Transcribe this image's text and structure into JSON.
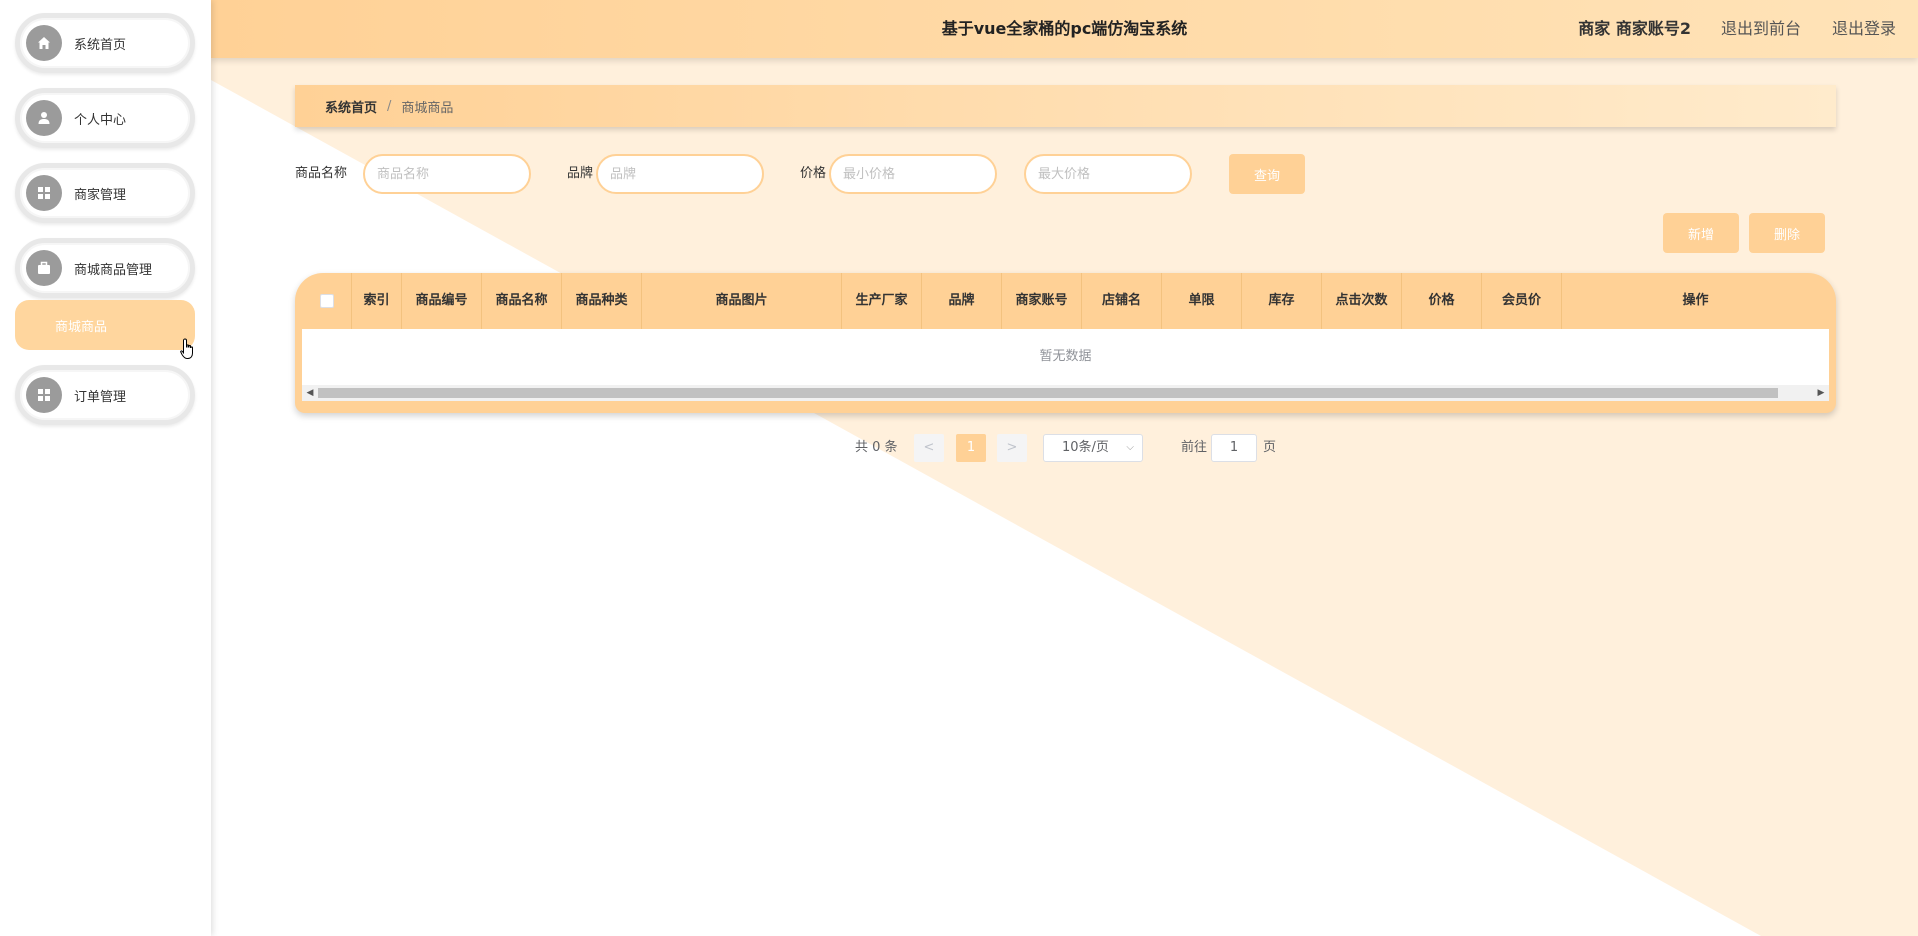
{
  "header": {
    "title": "基于vue全家桶的pc端仿淘宝系统",
    "user": "商家 商家账号2",
    "front_link": "退出到前台",
    "logout_link": "退出登录"
  },
  "sidebar": {
    "items": [
      {
        "label": "系统首页",
        "icon": "home-icon"
      },
      {
        "label": "个人中心",
        "icon": "user-icon"
      },
      {
        "label": "商家管理",
        "icon": "grid-icon"
      },
      {
        "label": "商城商品管理",
        "icon": "briefcase-icon"
      },
      {
        "label": "订单管理",
        "icon": "grid-icon"
      }
    ],
    "active_sub": "商城商品"
  },
  "breadcrumb": {
    "home": "系统首页",
    "separator": "/",
    "current": "商城商品"
  },
  "search": {
    "name_label": "商品名称",
    "name_placeholder": "商品名称",
    "brand_label": "品牌",
    "brand_placeholder": "品牌",
    "price_label": "价格",
    "min_price_placeholder": "最小价格",
    "max_price_placeholder": "最大价格",
    "query_button": "查询"
  },
  "actions": {
    "add": "新增",
    "delete": "删除"
  },
  "table": {
    "columns": [
      "索引",
      "商品编号",
      "商品名称",
      "商品种类",
      "商品图片",
      "生产厂家",
      "品牌",
      "商家账号",
      "店铺名",
      "单限",
      "库存",
      "点击次数",
      "价格",
      "会员价",
      "操作"
    ],
    "empty_text": "暂无数据"
  },
  "pager": {
    "total": "共 0 条",
    "prev": "<",
    "current_page": "1",
    "next": ">",
    "page_size": "10条/页",
    "goto_label": "前往",
    "goto_value": "1",
    "page_suffix": "页"
  },
  "colors": {
    "accent": "#ffd196",
    "accent_light": "#ffe3b8",
    "background_triangle": "#fff0dc"
  }
}
